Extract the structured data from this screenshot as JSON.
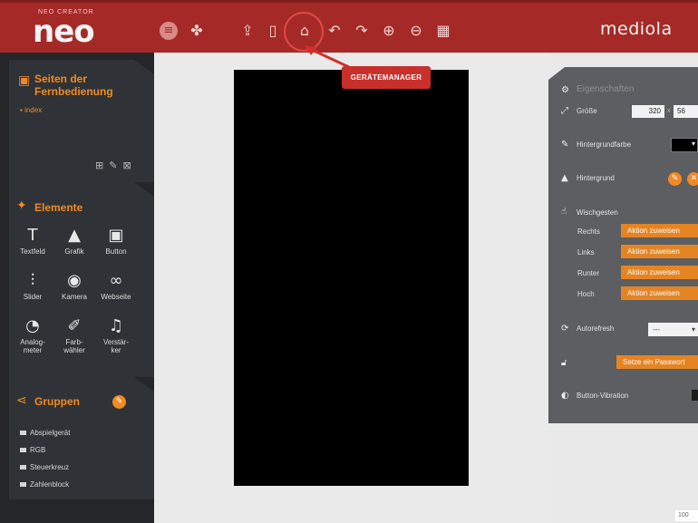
{
  "topbar": {
    "logo_small": "NEO CREATOR",
    "logo": "neo",
    "brand": "mediola",
    "icons": [
      "menu-icon",
      "puzzle-icon",
      "upload-icon",
      "phone-icon",
      "home-device-icon",
      "undo-icon",
      "redo-icon",
      "zoom-in-icon",
      "zoom-out-icon",
      "grid-icon"
    ]
  },
  "tooltip": {
    "label": "GERÄTEMANAGER",
    "color": "#c9302c"
  },
  "pages": {
    "title": "Seiten der Fernbedienung",
    "title_line1": "Seiten der",
    "title_line2": "Fernbedienung",
    "items": [
      {
        "label": "index"
      }
    ]
  },
  "elements": {
    "title": "Elemente",
    "items": [
      {
        "label": "Textfeld",
        "icon": "text-field-icon"
      },
      {
        "label": "Grafik",
        "icon": "image-icon"
      },
      {
        "label": "Button",
        "icon": "button-icon"
      },
      {
        "label": "Slider",
        "icon": "slider-icon"
      },
      {
        "label": "Kamera",
        "icon": "camera-icon"
      },
      {
        "label": "Webseite",
        "icon": "link-icon"
      },
      {
        "label1": "Analog-",
        "label2": "meter",
        "icon": "gauge-icon"
      },
      {
        "label1": "Farb-",
        "label2": "wähler",
        "icon": "color-picker-icon"
      },
      {
        "label1": "Verstär-",
        "label2": "ker",
        "icon": "music-icon"
      }
    ]
  },
  "groups": {
    "title": "Gruppen",
    "items": [
      {
        "label": "Abspielgerät"
      },
      {
        "label": "RGB"
      },
      {
        "label": "Steuerkreuz"
      },
      {
        "label": "Zahlenblock"
      }
    ]
  },
  "properties": {
    "title": "Eigenschaften",
    "size_label": "Größe",
    "width": "320",
    "height": "56",
    "bgcolor_label": "Hintergrundfarbe",
    "background_label": "Hintergrund",
    "swipe_label": "Wischgesten",
    "swipes": [
      {
        "dir": "Rechts",
        "action": "Aktion zuweisen"
      },
      {
        "dir": "Links",
        "action": "Aktion zuweisen"
      },
      {
        "dir": "Runter",
        "action": "Aktion zuweisen"
      },
      {
        "dir": "Hoch",
        "action": "Aktion zuweisen"
      }
    ],
    "autorefresh_label": "Autorefresh",
    "autorefresh_value": "---",
    "password_button": "Setze ein Passwort",
    "vibration_label": "Button-Vibration"
  },
  "zoom": "100",
  "colors": {
    "topbar": "#a52a27",
    "accent": "#f08a24",
    "sidebar": "#24262a",
    "props": "#5c5e61"
  }
}
